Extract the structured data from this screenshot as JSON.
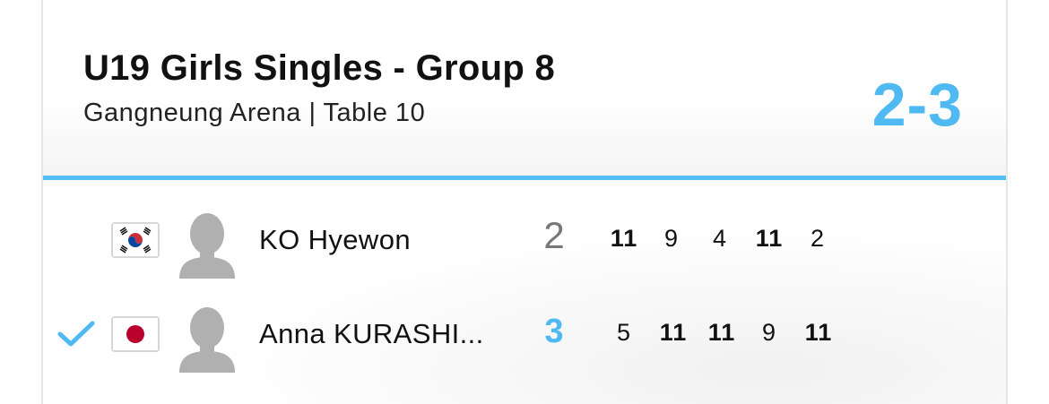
{
  "match": {
    "title": "U19 Girls Singles - Group 8",
    "venue": "Gangneung Arena | Table 10",
    "score": "2-3"
  },
  "colors": {
    "accent": "#4fb9f2",
    "winner_check": "#4fb9f2"
  },
  "players": [
    {
      "name": "KO Hyewon",
      "flag_icon": "korea-flag-icon",
      "sets_won": "2",
      "is_winner": false,
      "games": [
        "11",
        "9",
        "4",
        "11",
        "2"
      ]
    },
    {
      "name": "Anna KURASHI...",
      "flag_icon": "japan-flag-icon",
      "sets_won": "3",
      "is_winner": true,
      "games": [
        "5",
        "11",
        "11",
        "9",
        "11"
      ]
    }
  ]
}
